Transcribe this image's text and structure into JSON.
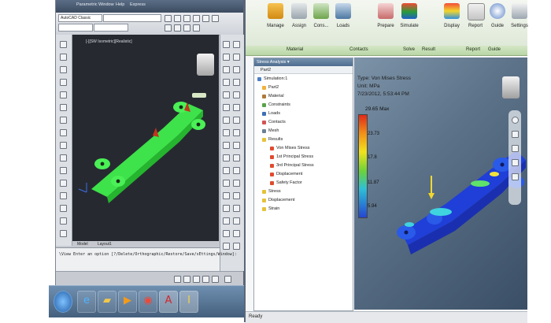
{
  "autocad": {
    "menu": [
      "Parametric",
      "Window",
      "Help",
      "Express"
    ],
    "workspace_combo": "AutoCAD Classic",
    "viewport_label": "[-][SW Isometric][Realistic]",
    "layout_tabs": [
      "Model",
      "Layout1"
    ],
    "command_line": "\\View Enter an option [?/Delete/Orthographic/Restore/Save/sEttings/Window]:"
  },
  "inventor": {
    "ribbon_buttons": [
      "Manage",
      "Assign",
      "Cons...",
      "Loads",
      "Prepare",
      "Simulate",
      "Display",
      "Report",
      "Guide",
      "Settings"
    ],
    "ribbon_groups": [
      "Material",
      "Contacts",
      "Solve",
      "Result",
      "Report",
      "Guide"
    ],
    "browser_title": "Stress Analysis ▾",
    "browser_part": "Part2",
    "tree": [
      "Simulation:1",
      "Part2",
      "Material",
      "Constraints",
      "Loads",
      "Contacts",
      "Mesh",
      "Results",
      "Von Mises Stress",
      "1st Principal Stress",
      "3rd Principal Stress",
      "Displacement",
      "Safety Factor",
      "Stress",
      "Displacement",
      "Strain"
    ],
    "result_lines": [
      "Type: Von Mises Stress",
      "Unit: MPa",
      "7/23/2012, 5:53:44 PM"
    ],
    "legend_max": "29.65 Max",
    "legend_ticks": [
      "23.73",
      "17.8",
      "11.87",
      "5.94"
    ],
    "status": "Ready"
  },
  "taskbar_icons": [
    "windows-start",
    "internet-explorer",
    "file-explorer",
    "media-player",
    "chrome",
    "autocad",
    "inventor"
  ],
  "colors": {
    "model_green": "#3ee24a",
    "fea_blue": "#1f3fd8",
    "ribbon_green": "#dfe9d8"
  }
}
